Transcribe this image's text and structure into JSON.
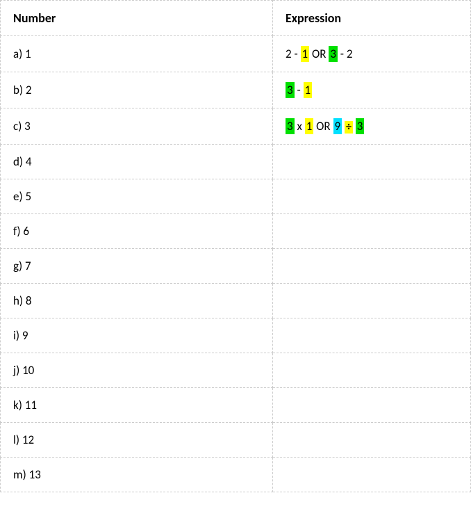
{
  "headers": {
    "number": "Number",
    "expression": "Expression"
  },
  "rows": [
    {
      "label": "a) 1",
      "expression": [
        {
          "text": "2 - "
        },
        {
          "text": "1",
          "highlight": "yellow"
        },
        {
          "text": " OR "
        },
        {
          "text": "3",
          "highlight": "green"
        },
        {
          "text": " - 2"
        }
      ]
    },
    {
      "label": "b) 2",
      "expression": [
        {
          "text": "3",
          "highlight": "green"
        },
        {
          "text": " - "
        },
        {
          "text": "1",
          "highlight": "yellow"
        }
      ]
    },
    {
      "label": "c) 3",
      "expression": [
        {
          "text": "3",
          "highlight": "green"
        },
        {
          "text": " x "
        },
        {
          "text": "1",
          "highlight": "yellow"
        },
        {
          "text": " OR "
        },
        {
          "text": "9",
          "highlight": "cyan"
        },
        {
          "text": " "
        },
        {
          "text": "÷",
          "highlight": "yellow",
          "symbol": "divide"
        },
        {
          "text": " "
        },
        {
          "text": "3",
          "highlight": "green"
        }
      ]
    },
    {
      "label": "d) 4",
      "expression": []
    },
    {
      "label": "e) 5",
      "expression": []
    },
    {
      "label": "f) 6",
      "expression": []
    },
    {
      "label": "g) 7",
      "expression": []
    },
    {
      "label": "h) 8",
      "expression": []
    },
    {
      "label": "i) 9",
      "expression": []
    },
    {
      "label": "j) 10",
      "expression": []
    },
    {
      "label": "k) 11",
      "expression": []
    },
    {
      "label": "l) 12",
      "expression": []
    },
    {
      "label": "m) 13",
      "expression": []
    }
  ]
}
